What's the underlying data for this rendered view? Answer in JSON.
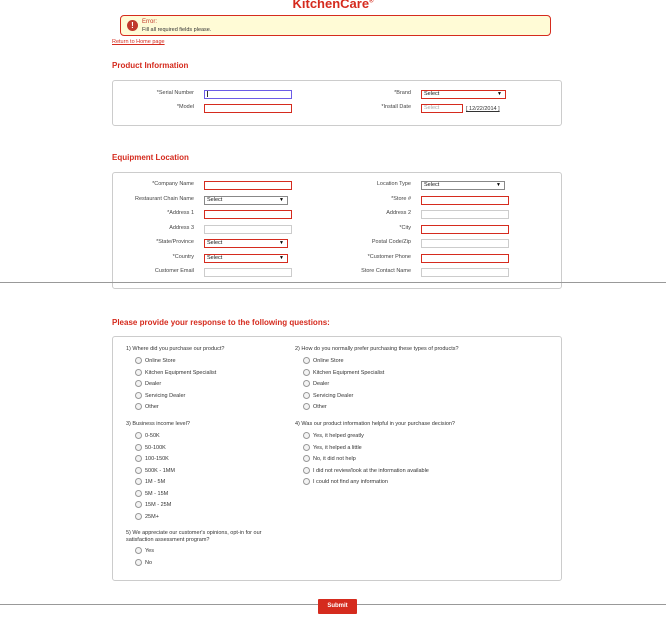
{
  "brand": {
    "logo_text": "KitchenCare",
    "logo_mark": "®"
  },
  "error": {
    "icon": "!",
    "title": "Error:",
    "message": "Fill all required fields please."
  },
  "return_link": "Return to Home page",
  "product_info": {
    "title": "Product Information",
    "serial_label": "*Serial Number",
    "model_label": "*Model",
    "brand_label": "*Brand",
    "brand_value": "Select",
    "install_label": "*Install Date",
    "install_placeholder": "Select",
    "install_date_link": "[ 12/22/2014 ]"
  },
  "equipment": {
    "title": "Equipment Location",
    "company_label": "*Company Name",
    "chain_label": "Restaurant Chain Name",
    "chain_value": "Select",
    "address1_label": "*Address 1",
    "address3_label": "Address 3",
    "state_label": "*State/Province",
    "state_value": "Select",
    "country_label": "*Country",
    "country_value": "Select",
    "email_label": "Customer Email",
    "location_type_label": "Location Type",
    "location_type_value": "Select",
    "store_label": "*Store #",
    "address2_label": "Address 2",
    "city_label": "*City",
    "postal_label": "Postal Code/Zip",
    "phone_label": "*Customer Phone",
    "store_contact_label": "Store Contact Name"
  },
  "questions": {
    "title": "Please provide your response to the following questions:",
    "q1": {
      "text": "1) Where did you purchase our product?",
      "options": [
        "Online Store",
        "Kitchen Equipment Specialist",
        "Dealer",
        "Servicing Dealer",
        "Other"
      ]
    },
    "q2": {
      "text": "2) How do you normally prefer purchasing these types of products?",
      "options": [
        "Online Store",
        "Kitchen Equipment Specialist",
        "Dealer",
        "Servicing Dealer",
        "Other"
      ]
    },
    "q3": {
      "text": "3) Business income level?",
      "options": [
        "0-50K",
        "50-100K",
        "100-150K",
        "500K - 1MM",
        "1M - 5M",
        "5M - 15M",
        "15M - 25M",
        "25M+"
      ]
    },
    "q4": {
      "text": "4) Was our product information helpful in your purchase decision?",
      "options": [
        "Yes, it helped greatly",
        "Yes, it helped a little",
        "No, it did not help",
        "I did not review/look at the information available",
        "I could not find any information"
      ]
    },
    "q5": {
      "text_line1": "5) We appreciate our customer's opinions, opt-in for our",
      "text_line2": "satisfaction assessment program?",
      "options": [
        "Yes",
        "No"
      ]
    }
  },
  "submit_label": "Submit"
}
